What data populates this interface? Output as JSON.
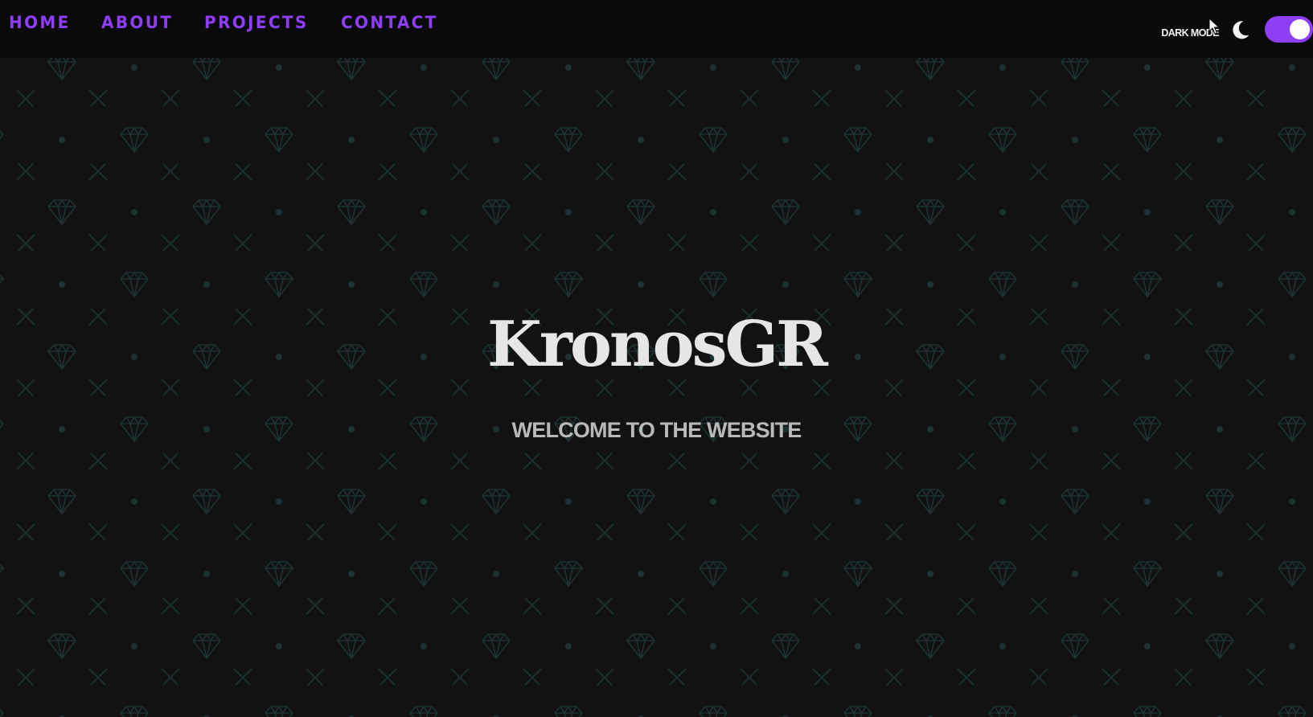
{
  "nav": {
    "links": [
      {
        "label": "HOME"
      },
      {
        "label": "ABOUT"
      },
      {
        "label": "PROJECTS"
      },
      {
        "label": "CONTACT"
      }
    ]
  },
  "theme": {
    "label": "DARK MODE",
    "icon": "moon-icon",
    "toggle_on": true
  },
  "hero": {
    "title": "KronosGR",
    "subtitle": "WELCOME TO THE WEBSITE"
  },
  "colors": {
    "accent": "#8e3ef5",
    "background": "#121212",
    "navbar": "#0a0a0a",
    "pattern": "#1d3232"
  },
  "background_pattern": {
    "motif": "diamond-icon"
  }
}
